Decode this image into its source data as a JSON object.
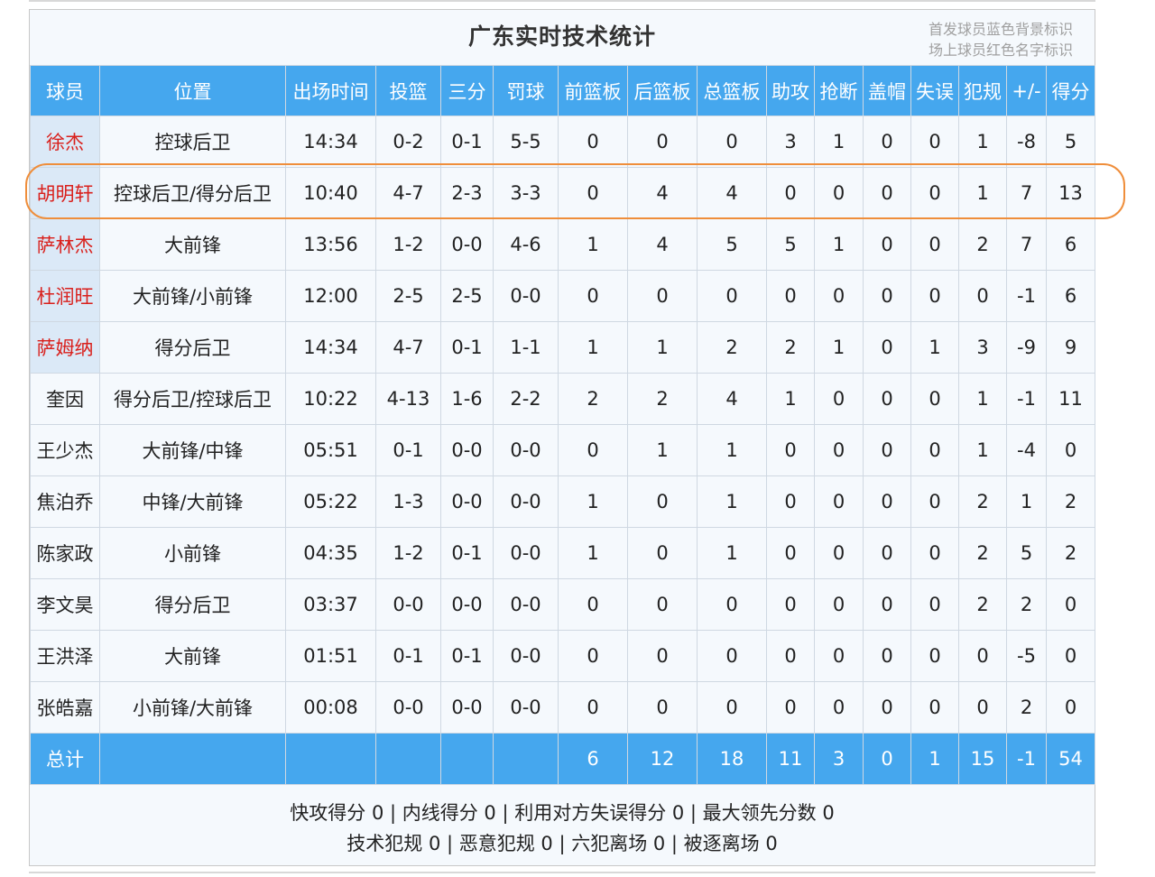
{
  "title": "广东实时技术统计",
  "legend": [
    "首发球员蓝色背景标识",
    "场上球员红色名字标识"
  ],
  "colors": {
    "header_bg": "#45a7ee",
    "starter_bg": "#dbe9f7",
    "oncourt_name": "#d9201c",
    "highlight": "#ef8e3b"
  },
  "headers": [
    "球员",
    "位置",
    "出场时间",
    "投篮",
    "三分",
    "罚球",
    "前篮板",
    "后篮板",
    "总篮板",
    "助攻",
    "抢断",
    "盖帽",
    "失误",
    "犯规",
    "+/-",
    "得分"
  ],
  "players": [
    {
      "name": "徐杰",
      "pos": "控球后卫",
      "min": "14:34",
      "fg": "0-2",
      "tp": "0-1",
      "ft": "5-5",
      "oreb": "0",
      "dreb": "0",
      "reb": "0",
      "ast": "3",
      "stl": "1",
      "blk": "0",
      "tov": "0",
      "pf": "1",
      "pm": "-8",
      "pts": "5",
      "starter": true,
      "oncourt": true
    },
    {
      "name": "胡明轩",
      "pos": "控球后卫/得分后卫",
      "min": "10:40",
      "fg": "4-7",
      "tp": "2-3",
      "ft": "3-3",
      "oreb": "0",
      "dreb": "4",
      "reb": "4",
      "ast": "0",
      "stl": "0",
      "blk": "0",
      "tov": "0",
      "pf": "1",
      "pm": "7",
      "pts": "13",
      "starter": true,
      "oncourt": true
    },
    {
      "name": "萨林杰",
      "pos": "大前锋",
      "min": "13:56",
      "fg": "1-2",
      "tp": "0-0",
      "ft": "4-6",
      "oreb": "1",
      "dreb": "4",
      "reb": "5",
      "ast": "5",
      "stl": "1",
      "blk": "0",
      "tov": "0",
      "pf": "2",
      "pm": "7",
      "pts": "6",
      "starter": true,
      "oncourt": true
    },
    {
      "name": "杜润旺",
      "pos": "大前锋/小前锋",
      "min": "12:00",
      "fg": "2-5",
      "tp": "2-5",
      "ft": "0-0",
      "oreb": "0",
      "dreb": "0",
      "reb": "0",
      "ast": "0",
      "stl": "0",
      "blk": "0",
      "tov": "0",
      "pf": "0",
      "pm": "-1",
      "pts": "6",
      "starter": true,
      "oncourt": true
    },
    {
      "name": "萨姆纳",
      "pos": "得分后卫",
      "min": "14:34",
      "fg": "4-7",
      "tp": "0-1",
      "ft": "1-1",
      "oreb": "1",
      "dreb": "1",
      "reb": "2",
      "ast": "2",
      "stl": "1",
      "blk": "0",
      "tov": "1",
      "pf": "3",
      "pm": "-9",
      "pts": "9",
      "starter": true,
      "oncourt": true
    },
    {
      "name": "奎因",
      "pos": "得分后卫/控球后卫",
      "min": "10:22",
      "fg": "4-13",
      "tp": "1-6",
      "ft": "2-2",
      "oreb": "2",
      "dreb": "2",
      "reb": "4",
      "ast": "1",
      "stl": "0",
      "blk": "0",
      "tov": "0",
      "pf": "1",
      "pm": "-1",
      "pts": "11",
      "starter": false,
      "oncourt": false
    },
    {
      "name": "王少杰",
      "pos": "大前锋/中锋",
      "min": "05:51",
      "fg": "0-1",
      "tp": "0-0",
      "ft": "0-0",
      "oreb": "0",
      "dreb": "1",
      "reb": "1",
      "ast": "0",
      "stl": "0",
      "blk": "0",
      "tov": "0",
      "pf": "1",
      "pm": "-4",
      "pts": "0",
      "starter": false,
      "oncourt": false
    },
    {
      "name": "焦泊乔",
      "pos": "中锋/大前锋",
      "min": "05:22",
      "fg": "1-3",
      "tp": "0-0",
      "ft": "0-0",
      "oreb": "1",
      "dreb": "0",
      "reb": "1",
      "ast": "0",
      "stl": "0",
      "blk": "0",
      "tov": "0",
      "pf": "2",
      "pm": "1",
      "pts": "2",
      "starter": false,
      "oncourt": false
    },
    {
      "name": "陈家政",
      "pos": "小前锋",
      "min": "04:35",
      "fg": "1-2",
      "tp": "0-1",
      "ft": "0-0",
      "oreb": "1",
      "dreb": "0",
      "reb": "1",
      "ast": "0",
      "stl": "0",
      "blk": "0",
      "tov": "0",
      "pf": "2",
      "pm": "5",
      "pts": "2",
      "starter": false,
      "oncourt": false
    },
    {
      "name": "李文昊",
      "pos": "得分后卫",
      "min": "03:37",
      "fg": "0-0",
      "tp": "0-0",
      "ft": "0-0",
      "oreb": "0",
      "dreb": "0",
      "reb": "0",
      "ast": "0",
      "stl": "0",
      "blk": "0",
      "tov": "0",
      "pf": "2",
      "pm": "2",
      "pts": "0",
      "starter": false,
      "oncourt": false
    },
    {
      "name": "王洪泽",
      "pos": "大前锋",
      "min": "01:51",
      "fg": "0-1",
      "tp": "0-1",
      "ft": "0-0",
      "oreb": "0",
      "dreb": "0",
      "reb": "0",
      "ast": "0",
      "stl": "0",
      "blk": "0",
      "tov": "0",
      "pf": "0",
      "pm": "-5",
      "pts": "0",
      "starter": false,
      "oncourt": false
    },
    {
      "name": "张皓嘉",
      "pos": "小前锋/大前锋",
      "min": "00:08",
      "fg": "0-0",
      "tp": "0-0",
      "ft": "0-0",
      "oreb": "0",
      "dreb": "0",
      "reb": "0",
      "ast": "0",
      "stl": "0",
      "blk": "0",
      "tov": "0",
      "pf": "0",
      "pm": "2",
      "pts": "0",
      "starter": false,
      "oncourt": false
    }
  ],
  "totals": {
    "label": "总计",
    "oreb": "6",
    "dreb": "12",
    "reb": "18",
    "ast": "11",
    "stl": "3",
    "blk": "0",
    "tov": "1",
    "pf": "15",
    "pm": "-1",
    "pts": "54"
  },
  "footer": {
    "line1": "快攻得分 0 | 内线得分 0 | 利用对方失误得分 0 | 最大领先分数 0",
    "line2": "技术犯规 0 | 恶意犯规 0 | 六犯离场 0 | 被逐离场 0"
  },
  "highlighted_player": "胡明轩"
}
